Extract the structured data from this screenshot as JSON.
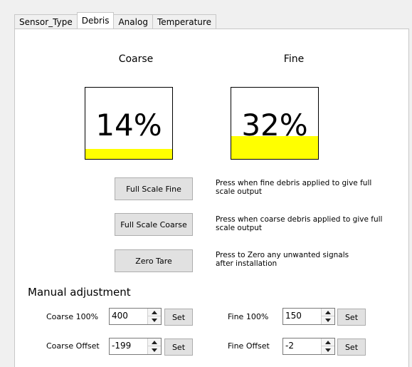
{
  "tabs": [
    {
      "label": "Sensor_Type"
    },
    {
      "label": "Debris"
    },
    {
      "label": "Analog"
    },
    {
      "label": "Temperature"
    }
  ],
  "colors": {
    "gauge_fill": "#ffff00"
  },
  "coarse": {
    "caption": "Coarse",
    "value_text": "14%",
    "level_fraction": 0.14
  },
  "fine": {
    "caption": "Fine",
    "value_text": "32%",
    "level_fraction": 0.32
  },
  "actions": {
    "full_scale_fine": {
      "label": "Full Scale Fine",
      "desc1": "Press when fine debris applied to give full",
      "desc2": "scale output"
    },
    "full_scale_coarse": {
      "label": "Full Scale Coarse",
      "desc1": "Press when coarse debris applied to give full",
      "desc2": "scale output"
    },
    "zero_tare": {
      "label": "Zero Tare",
      "desc1": "Press to Zero any unwanted signals",
      "desc2": "after installation"
    }
  },
  "manual": {
    "title": "Manual adjustment",
    "coarse_100": {
      "label": "Coarse 100%",
      "value": "400",
      "set": "Set"
    },
    "coarse_offset": {
      "label": "Coarse Offset",
      "value": "-199",
      "set": "Set"
    },
    "fine_100": {
      "label": "Fine 100%",
      "value": "150",
      "set": "Set"
    },
    "fine_offset": {
      "label": "Fine Offset",
      "value": "-2",
      "set": "Set"
    }
  }
}
